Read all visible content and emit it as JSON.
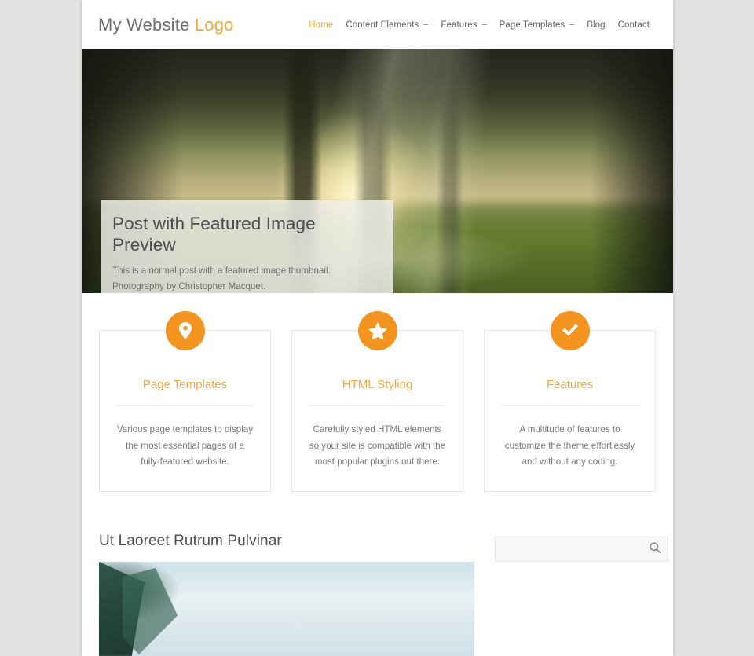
{
  "site": {
    "logo_primary": "My Website",
    "logo_accent": "Logo"
  },
  "nav": {
    "items": [
      {
        "label": "Home",
        "active": true,
        "has_dropdown": false
      },
      {
        "label": "Content Elements",
        "active": false,
        "has_dropdown": true
      },
      {
        "label": "Features",
        "active": false,
        "has_dropdown": true
      },
      {
        "label": "Page Templates",
        "active": false,
        "has_dropdown": true
      },
      {
        "label": "Blog",
        "active": false,
        "has_dropdown": false
      },
      {
        "label": "Contact",
        "active": false,
        "has_dropdown": false
      }
    ]
  },
  "hero": {
    "title": "Post with Featured Image Preview",
    "description": "This is a normal post with a featured image thumbnail. Photography by Christopher Macquet."
  },
  "features": [
    {
      "icon": "map-pin-icon",
      "title": "Page Templates",
      "text": "Various page templates to display the most essential pages of a fully-featured website."
    },
    {
      "icon": "star-icon",
      "title": "HTML Styling",
      "text": "Carefully styled HTML elements so your site is compatible with the most popular plugins out there."
    },
    {
      "icon": "check-icon",
      "title": "Features",
      "text": "A multitude of features to customize the theme effortlessly and without any coding."
    }
  ],
  "post": {
    "heading": "Ut Laoreet Rutrum Pulvinar"
  },
  "sidebar": {
    "search": {
      "value": "",
      "placeholder": "",
      "icon": "search-icon"
    }
  },
  "colors": {
    "accent": "#f2941d",
    "accent_light": "#f0a93c",
    "page_background": "#e2e2e2",
    "text": "#4b4d50",
    "muted_text": "#76787a"
  }
}
